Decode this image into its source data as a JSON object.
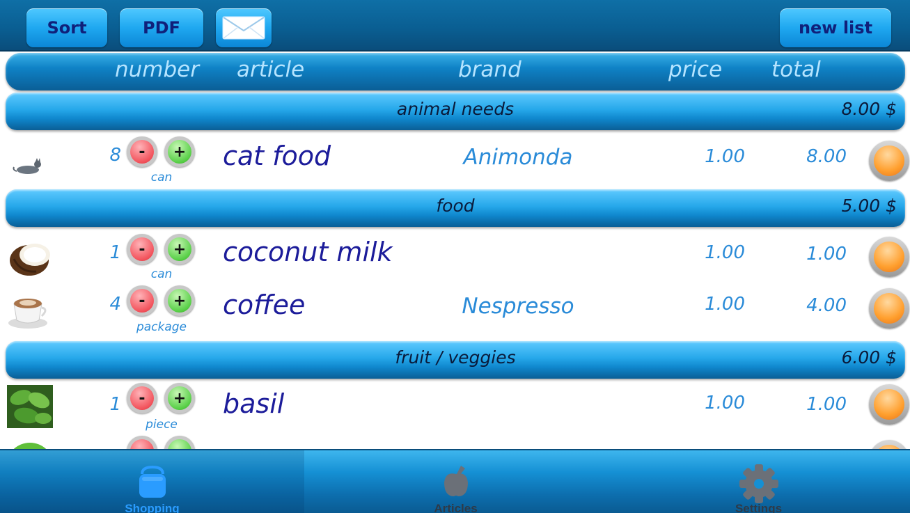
{
  "toolbar": {
    "sort_label": "Sort",
    "pdf_label": "PDF",
    "mail_icon": "envelope-icon",
    "new_list_label": "new list"
  },
  "columns": {
    "number": "number",
    "article": "article",
    "brand": "brand",
    "price": "price",
    "total": "total"
  },
  "categories": [
    {
      "name": "animal needs",
      "total": "8.00 $",
      "items": [
        {
          "image": "cat-icon",
          "number": "8",
          "unit": "can",
          "article": "cat food",
          "brand": "Animonda",
          "price": "1.00",
          "total": "8.00"
        }
      ]
    },
    {
      "name": "food",
      "total": "5.00 $",
      "items": [
        {
          "image": "coconut-icon",
          "number": "1",
          "unit": "can",
          "article": "coconut milk",
          "brand": "",
          "price": "1.00",
          "total": "1.00"
        },
        {
          "image": "coffee-cup-icon",
          "number": "4",
          "unit": "package",
          "article": "coffee",
          "brand": "Nespresso",
          "price": "1.00",
          "total": "4.00"
        }
      ]
    },
    {
      "name": "fruit / veggies",
      "total": "6.00 $",
      "items": [
        {
          "image": "basil-icon",
          "number": "1",
          "unit": "piece",
          "article": "basil",
          "brand": "",
          "price": "1.00",
          "total": "1.00"
        }
      ]
    }
  ],
  "item_controls": {
    "minus": "-",
    "plus": "+"
  },
  "tabs": [
    {
      "label": "Shopping",
      "icon": "shopping-bag-icon",
      "selected": true
    },
    {
      "label": "Articles",
      "icon": "apple-icon",
      "selected": false
    },
    {
      "label": "Settings",
      "icon": "gear-icon",
      "selected": false
    }
  ],
  "colors": {
    "toolbar": "#0a5f93",
    "button": "#1fa8f0",
    "button_text": "#10207a",
    "header_text": "#b5e4ff",
    "article_text": "#1c1c9a",
    "value_text": "#2a8bd8",
    "check_orange": "#ff9f2e",
    "tab_selected": "#2a9cff"
  }
}
